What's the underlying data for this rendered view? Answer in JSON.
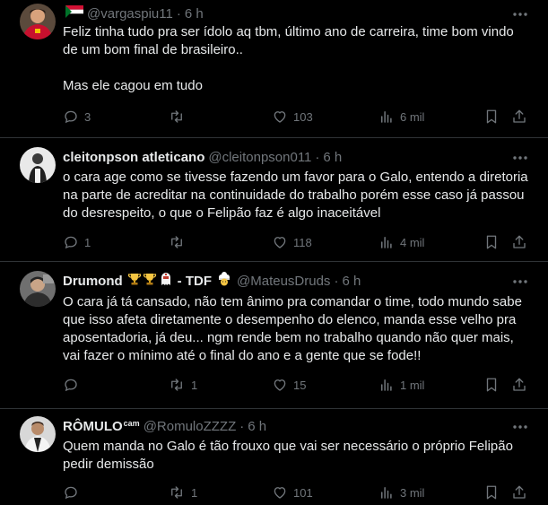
{
  "colors": {
    "background": "#000000",
    "text": "#e7e9ea",
    "muted": "#71767b",
    "divider": "#2f3336"
  },
  "tweets": [
    {
      "name": "",
      "handle": "@vargaspiu11",
      "time": "6 h",
      "flag_icon": "sudan-flag-icon",
      "text_lines": [
        "Feliz tinha tudo pra ser ídolo aq tbm, último ano de carreira, time bom vindo",
        "de um bom final de brasileiro..",
        "",
        "Mas ele cagou em tudo"
      ],
      "replies": "3",
      "retweets": "",
      "likes": "103",
      "views": "6 mil"
    },
    {
      "name": "cleitonpson atleticano",
      "handle": "@cleitonpson011",
      "time": "6 h",
      "text_lines": [
        "o cara age como se tivesse fazendo um favor para o Galo, entendo a diretoria",
        "na parte de acreditar na continuidade do trabalho porém esse caso já passou",
        "do desrespeito, o que o Felipão faz é algo inaceitável"
      ],
      "replies": "1",
      "retweets": "",
      "likes": "118",
      "views": "4 mil"
    },
    {
      "name": "Drumond",
      "name_suffix": "- TDF",
      "handle": "@MateusDruds",
      "time": "6 h",
      "text_lines": [
        "O cara já tá cansado, não tem ânimo pra comandar o time, todo mundo sabe",
        "que isso afeta diretamente o desempenho do elenco, manda esse velho pra",
        "aposentadoria, já deu... ngm rende bem no trabalho quando não quer mais,",
        "vai fazer o mínimo até o final do ano e a gente que se fode!!"
      ],
      "replies": "",
      "retweets": "1",
      "likes": "15",
      "views": "1 mil"
    },
    {
      "name": "RÔMULO",
      "name_sup": "cam",
      "handle": "@RomuloZZZZ",
      "time": "6 h",
      "text_lines": [
        "Quem manda no Galo é tão frouxo que vai ser necessário o próprio Felipão",
        "pedir demissão"
      ],
      "replies": "",
      "retweets": "1",
      "likes": "101",
      "views": "3 mil"
    }
  ]
}
